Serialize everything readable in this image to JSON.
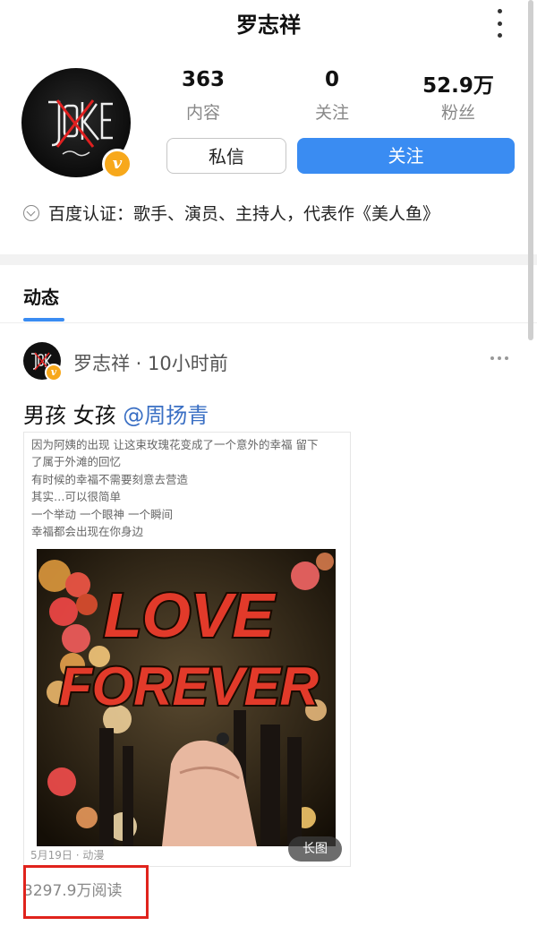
{
  "header": {
    "title": "罗志祥"
  },
  "profile": {
    "stats": [
      {
        "value": "363",
        "label": "内容"
      },
      {
        "value": "0",
        "label": "关注"
      },
      {
        "value": "52.9",
        "unit": "万",
        "label": "粉丝"
      }
    ],
    "message_label": "私信",
    "follow_label": "关注",
    "verification": "百度认证：歌手、演员、主持人，代表作《美人鱼》",
    "badge": "v"
  },
  "tabs": {
    "active": "动态"
  },
  "post": {
    "author_meta": "罗志祥 · 10小时前",
    "text": "男孩 女孩",
    "mention": "@周扬青",
    "card_lines": [
      "因为阿姨的出现 让这束玫瑰花变成了一个意外的幸福 留下",
      "了属于外滩的回忆",
      "有时候的幸福不需要刻意去营造",
      "其实…可以很简单",
      "一个举动 一个眼神 一个瞬间",
      "幸福都会出现在你身边"
    ],
    "image_text_line1": "LOVE",
    "image_text_line2": "FOREVER",
    "long_image_tag": "长图",
    "card_date": "5月19日 · 动漫",
    "reads": "3297.9万阅读"
  },
  "icons": {
    "kebab": "more-vertical-icon",
    "verify": "verify-check-icon",
    "post_more": "more-horizontal-icon"
  },
  "colors": {
    "accent": "#3a8cf2",
    "badge": "#f7a81b",
    "highlight": "#e0231c"
  }
}
